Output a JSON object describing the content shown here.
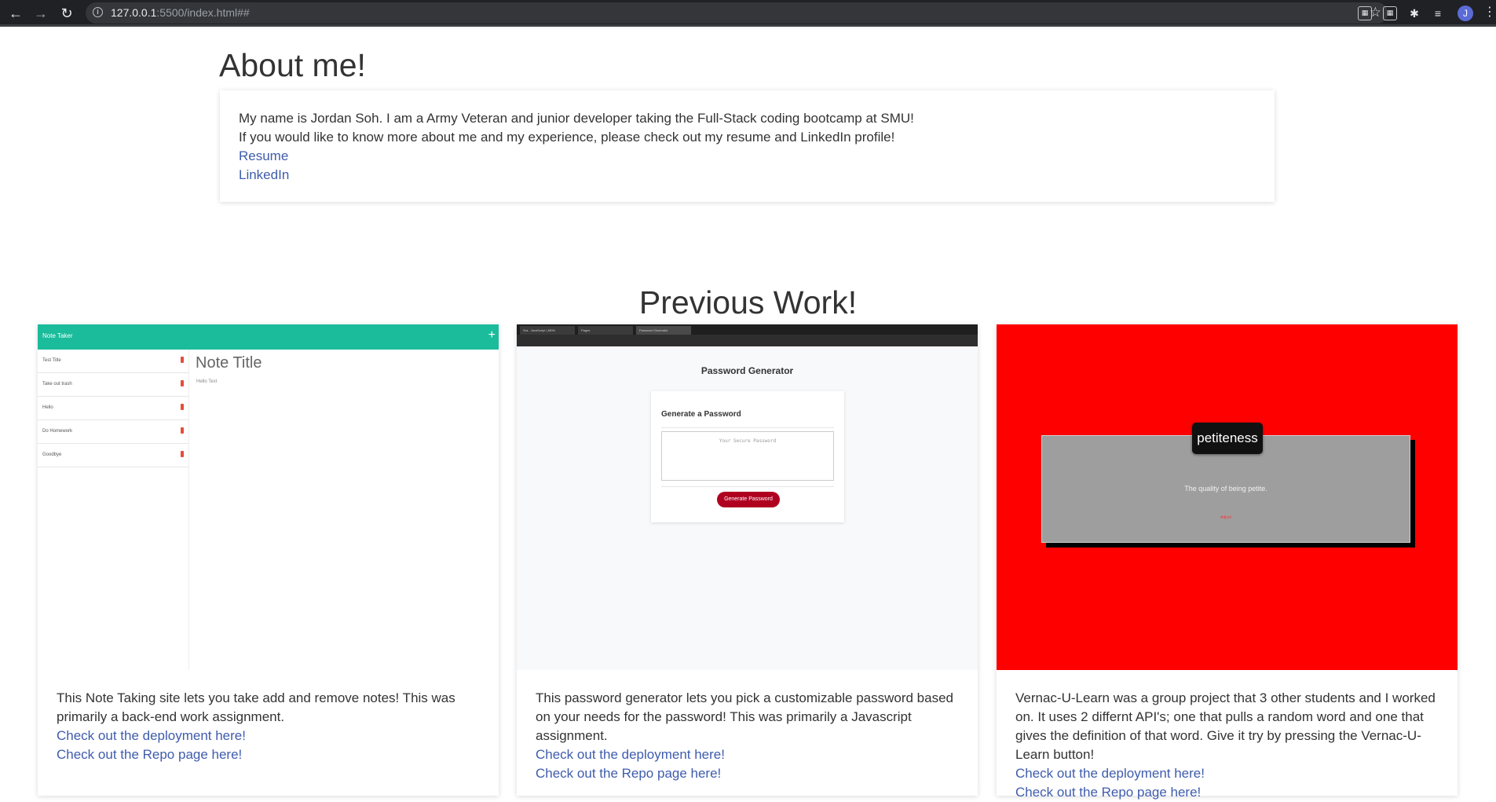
{
  "browser": {
    "url_host": "127.0.0.1",
    "url_rest": ":5500/index.html##",
    "avatar_letter": "J"
  },
  "about": {
    "title": "About me!",
    "line1": "My name is Jordan Soh. I am a Army Veteran and junior developer taking the Full-Stack coding bootcamp at SMU!",
    "line2": "If you would like to know more about me and my experience, please check out my resume and LinkedIn profile!",
    "resume_link": "Resume",
    "linkedin_link": "LinkedIn"
  },
  "work": {
    "title": "Previous Work!",
    "cards": [
      {
        "description": "This Note Taking site lets you take add and remove notes! This was primarily a back-end work assignment.",
        "deploy_link": "Check out the deployment here!",
        "repo_link": "Check out the Repo page here!",
        "thumb": {
          "brand": "Note Taker",
          "plus": "+",
          "items": [
            "Test Title",
            "Take out trash",
            "Hello",
            "Do Homework",
            "Goodbye"
          ],
          "note_title": "Note Title",
          "note_text": "Hello Text"
        }
      },
      {
        "description": "This password generator lets you pick a customizable password based on your needs for the password! This was primarily a Javascript assignment.",
        "deploy_link": "Check out the deployment here!",
        "repo_link": "Check out the Repo page here!",
        "thumb": {
          "tabs": [
            "Sra - JavaScript | MDN",
            "Pages",
            "Password Generator"
          ],
          "title": "Password Generator",
          "card_heading": "Generate a Password",
          "placeholder": "Your Secure Password",
          "button": "Generate Password"
        }
      },
      {
        "description": "Vernac-U-Learn was a group project that 3 other students and I worked on. It uses 2 differnt API's; one that pulls a random word and one that gives the definition of that word. Give it try by pressing the Vernac-U-Learn button!",
        "deploy_link": "Check out the deployment here!",
        "repo_link": "Check out the Repo page here!",
        "thumb": {
          "word": "petiteness",
          "definition": "The quality of being petite.",
          "small": "Adjust"
        }
      }
    ]
  },
  "colors": {
    "link": "#3f5cad",
    "note_teal": "#1abc9c",
    "vernac_red": "#ff0000",
    "generate_btn": "#b00020"
  }
}
